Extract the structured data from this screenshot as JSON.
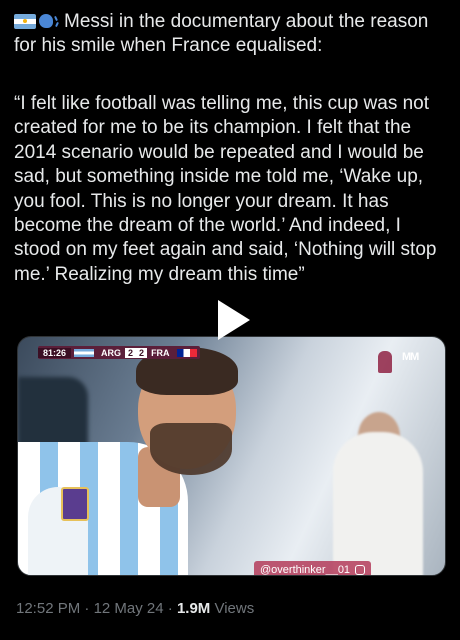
{
  "post": {
    "headline": "Messi in the documentary about the reason for his smile when France equalised:",
    "quote": "“I felt like football was telling me, this cup was not created for me to be its champion. I felt that the 2014 scenario would be repeated and I would be sad, but something inside me told me, ‘Wake up, you fool. This is no longer your dream. It has become the dream of the world.’ And indeed, I stood on my feet again and said, ‘Nothing will stop me.’ Realizing my dream this time”",
    "flag_icon": "argentina-flag-icon",
    "speaker_icon": "speaking-head-icon"
  },
  "video": {
    "time": "81:26",
    "team_home": "ARG",
    "score_home": "2",
    "score_away": "2",
    "team_away": "FRA",
    "broadcaster_logo": "MM",
    "watermark": "@overthinker__01"
  },
  "meta": {
    "time": "12:52 PM",
    "date": "12 May 24",
    "views_count": "1.9M",
    "views_label": "Views",
    "separator": "·"
  },
  "colors": {
    "background": "#000000",
    "text": "#e7e9ea",
    "muted": "#71767b"
  }
}
